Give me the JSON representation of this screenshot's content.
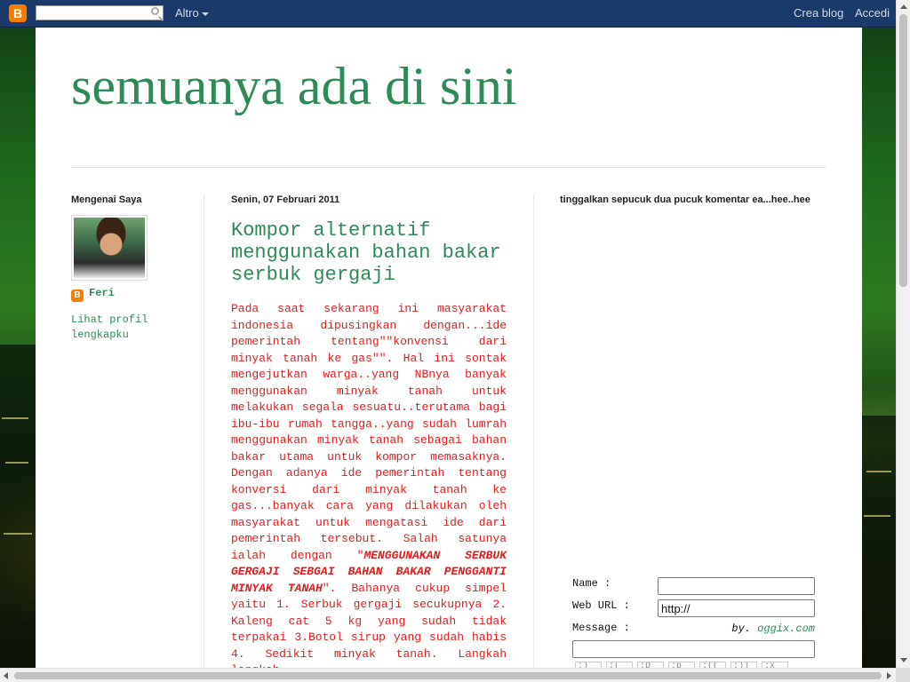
{
  "navbar": {
    "logo_letter": "B",
    "search_value": "",
    "more_label": "Altro",
    "create_blog_label": "Crea blog",
    "sign_in_label": "Accedi"
  },
  "blog": {
    "title": "semuanya ada di sini"
  },
  "left_sidebar": {
    "heading": "Mengenai Saya",
    "profile_name": "Feri",
    "profile_link": "Lihat profil lengkapku"
  },
  "post": {
    "date": "Senin, 07 Februari 2011",
    "title": "Kompor alternatif menggunakan bahan bakar serbuk gergaji",
    "body_before": "Pada saat sekarang ini masyarakat indonesia dipusingkan dengan...ide pemerintah tentang\"\"konvensi dari minyak tanah ke gas\"\". Hal ini sontak mengejutkan warga..yang NBnya banyak menggunakan minyak tanah untuk melakukan segala sesuatu..terutama bagi ibu-ibu rumah tangga..yang sudah lumrah menggunakan minyak tanah sebagai bahan bakar utama untuk kompor memasaknya. Dengan adanya ide pemerintah tentang konversi dari minyak tanah ke gas...banyak cara yang dilakukan oleh masyarakat untuk mengatasi ide dari pemerintah tersebut. Salah satunya ialah dengan \"",
    "body_emphasis": "MENGGUNAKAN SERBUK GERGAJI SEBGAI BAHAN BAKAR PENGGANTI MINYAK TANAH",
    "body_after": "\". Bahanya cukup simpel yaitu 1. Serbuk gergaji secukupnya 2. Kaleng cat 5 kg yang sudah tidak terpakai 3.Botol sirup yang sudah habis 4. Sedikit minyak tanah. Langkah langkah"
  },
  "right_sidebar": {
    "heading": "tinggalkan sepucuk dua pucuk komentar ea...hee..hee",
    "form": {
      "name_label": "Name :",
      "name_value": "",
      "url_label": "Web URL :",
      "url_value": "http://",
      "message_label": "Message :",
      "by_prefix": "by.",
      "by_link": "oggix.com",
      "smilies": [
        ":)",
        ":(",
        ":D",
        ":p",
        ":((",
        ":))",
        ":x"
      ]
    }
  },
  "colors": {
    "accent_green": "#2e8b57",
    "post_body_red": "#e21c1c",
    "navbar_blue": "#1b3a6b",
    "blogger_orange": "#f57d00"
  }
}
